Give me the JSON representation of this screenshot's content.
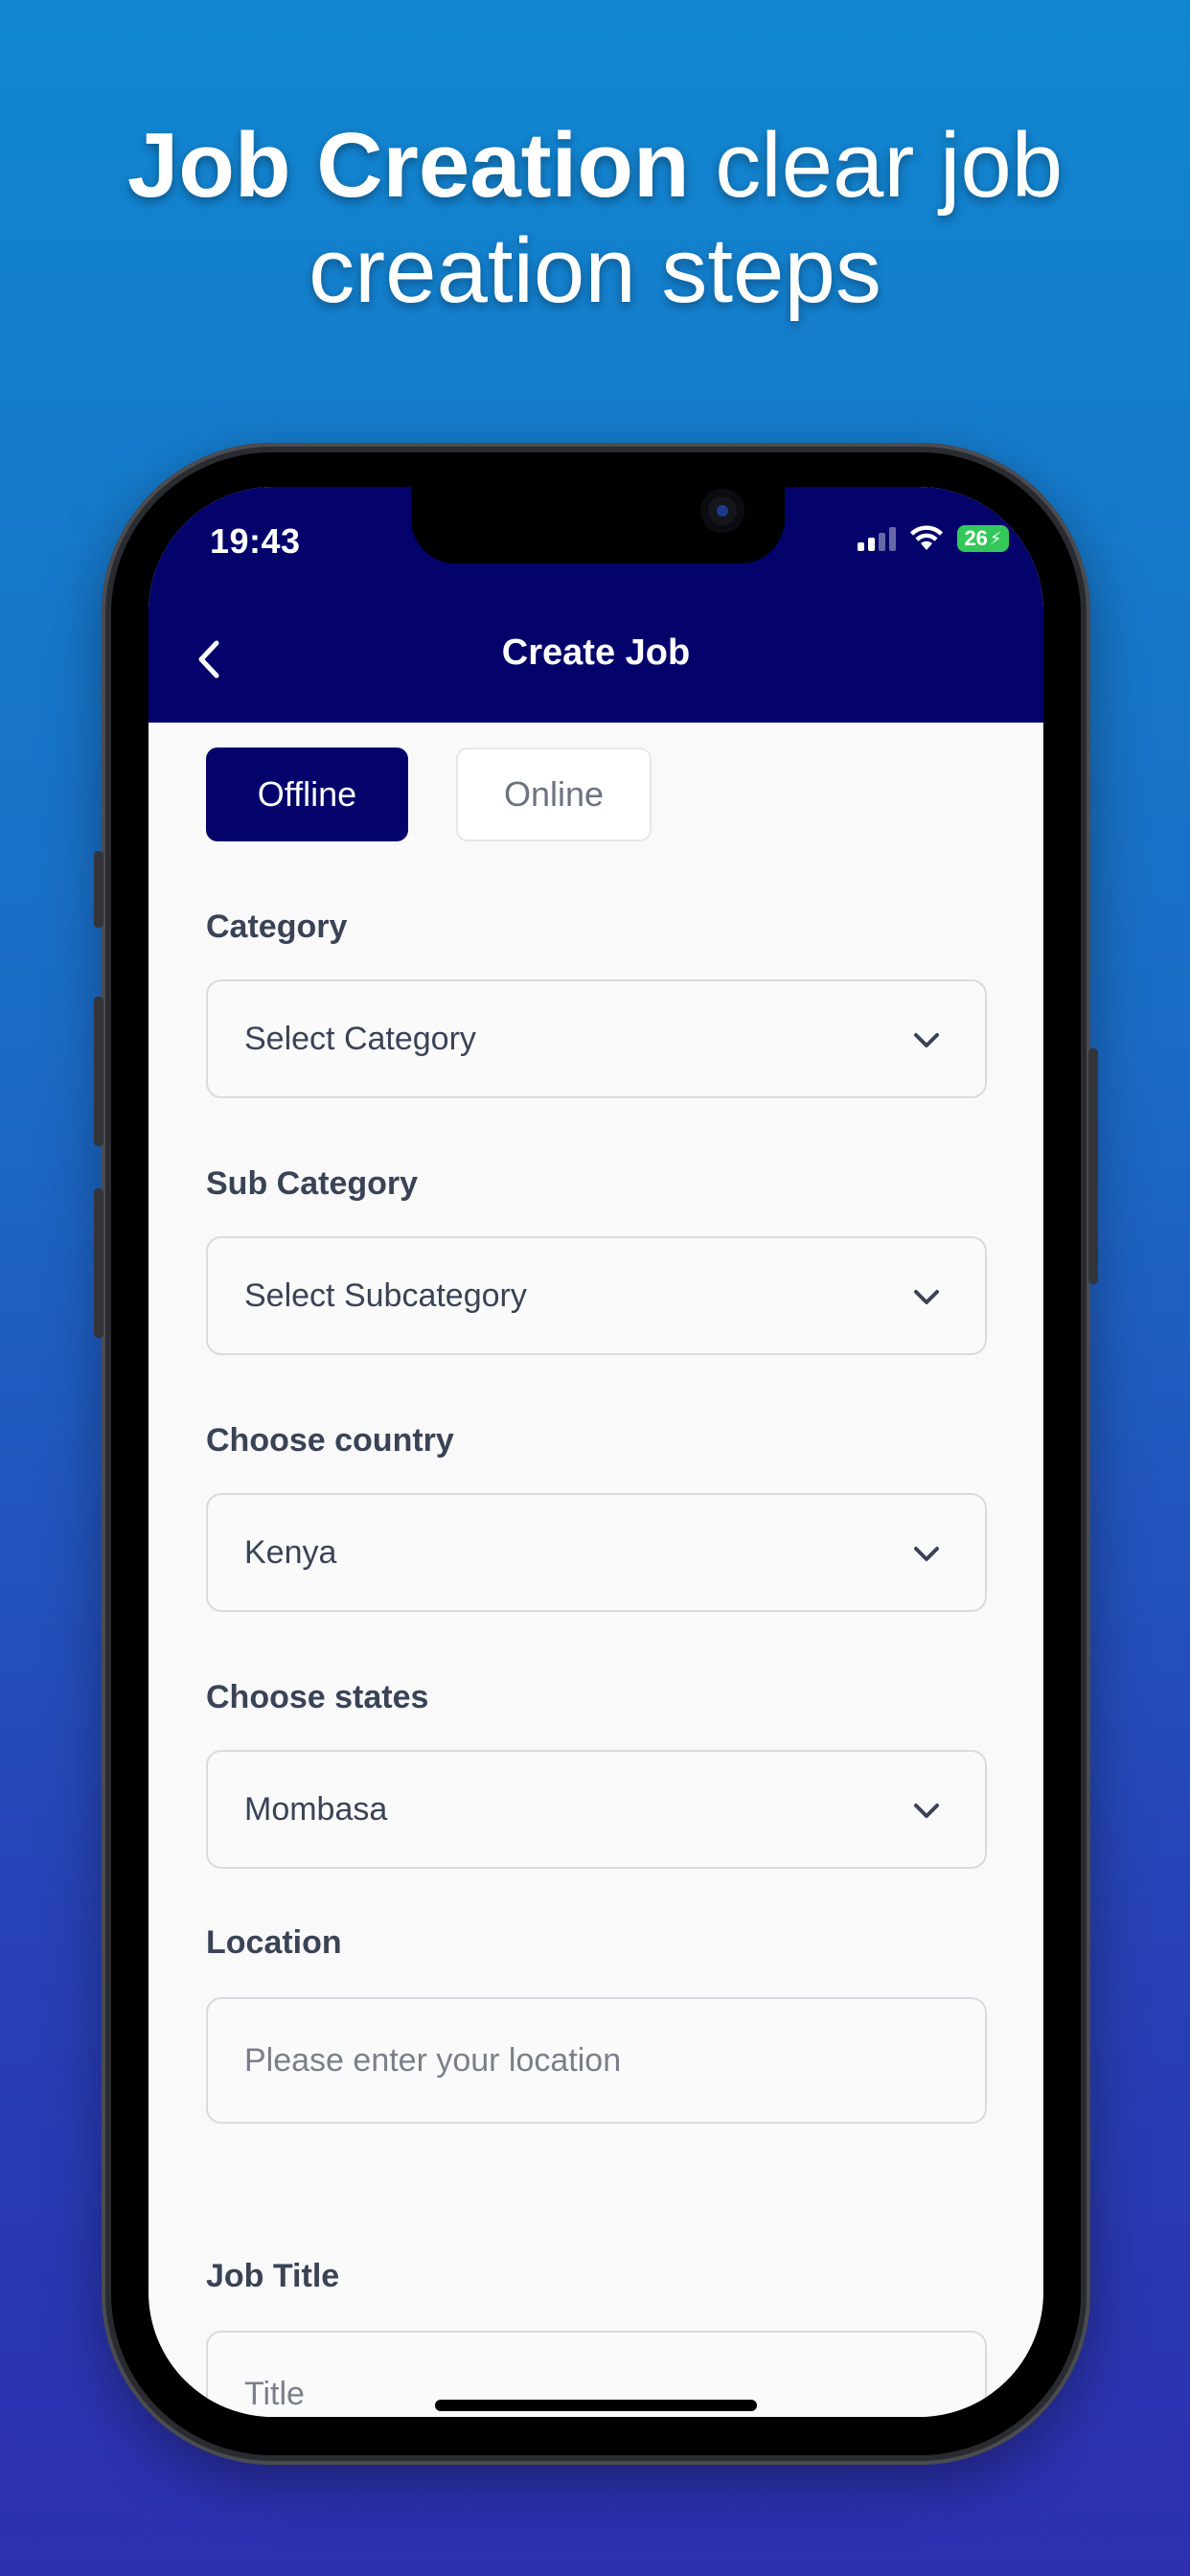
{
  "headline": {
    "bold": "Job Creation",
    "rest": " clear job creation steps"
  },
  "status_bar": {
    "time": "19:43",
    "battery": "26"
  },
  "nav": {
    "title": "Create Job"
  },
  "mode_toggle": {
    "offline_label": "Offline",
    "online_label": "Online",
    "selected": "Offline"
  },
  "form": {
    "category": {
      "label": "Category",
      "value": "Select Category"
    },
    "subcategory": {
      "label": "Sub Category",
      "value": "Select Subcategory"
    },
    "country": {
      "label": "Choose country",
      "value": "Kenya"
    },
    "state": {
      "label": "Choose states",
      "value": "Mombasa"
    },
    "location": {
      "label": "Location",
      "placeholder": "Please enter your location"
    },
    "job_title": {
      "label": "Job Title",
      "placeholder": "Title"
    }
  },
  "colors": {
    "primary": "#03036b",
    "background": "#f9f9fa",
    "accent_gradient_top": "#1187d0",
    "accent_gradient_bottom": "#2d2fb0"
  }
}
